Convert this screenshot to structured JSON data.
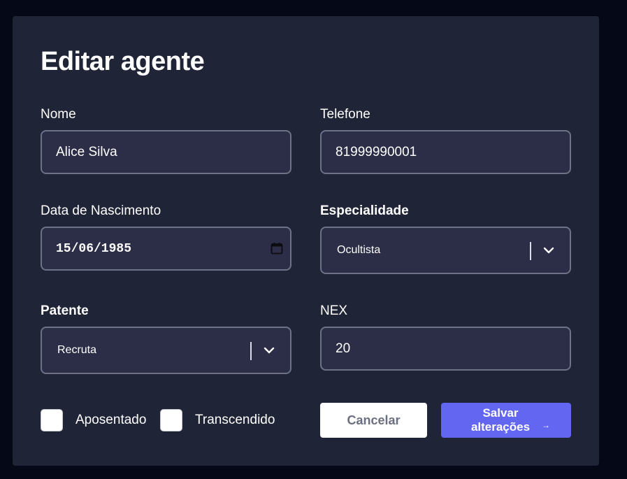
{
  "form": {
    "title": "Editar agente",
    "fields": {
      "nome": {
        "label": "Nome",
        "value": "Alice Silva"
      },
      "telefone": {
        "label": "Telefone",
        "value": "81999990001"
      },
      "nascimento": {
        "label": "Data de Nascimento",
        "value": "15/06/1985"
      },
      "especialidade": {
        "label": "Especialidade",
        "value": "Ocultista"
      },
      "patente": {
        "label": "Patente",
        "value": "Recruta"
      },
      "nex": {
        "label": "NEX",
        "value": "20"
      }
    },
    "checkboxes": {
      "aposentado": {
        "label": "Aposentado",
        "checked": false
      },
      "transcendido": {
        "label": "Transcendido",
        "checked": false
      }
    },
    "buttons": {
      "cancel": "Cancelar",
      "save": "Salvar alterações",
      "save_icon": "arrow-right-icon"
    }
  },
  "colors": {
    "background": "#050816",
    "card": "#1f2436",
    "field": "#2c2d47",
    "field_border": "#6e7287",
    "primary": "#6366f1"
  }
}
